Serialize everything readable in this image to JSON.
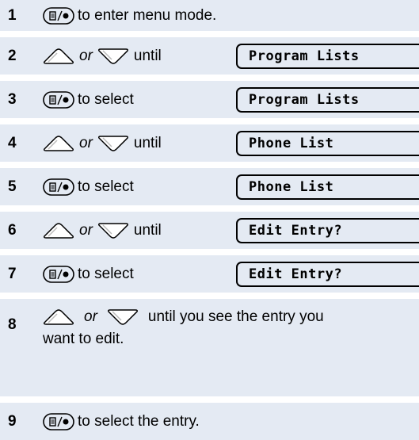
{
  "steps": [
    {
      "number": "1",
      "text": "to enter menu mode."
    },
    {
      "number": "2",
      "or_label": "or",
      "text": "until",
      "display": "Program Lists"
    },
    {
      "number": "3",
      "text": "to select",
      "display": "Program Lists"
    },
    {
      "number": "4",
      "or_label": "or",
      "text": "until",
      "display": "Phone List"
    },
    {
      "number": "5",
      "text": "to select",
      "display": "Phone List"
    },
    {
      "number": "6",
      "or_label": "or",
      "text": "until",
      "display": "Edit Entry?"
    },
    {
      "number": "7",
      "text": "to select",
      "display": "Edit Entry?"
    },
    {
      "number": "8",
      "or_label": "or",
      "text_line1": "until you see the entry you",
      "text_line2": "want to edit."
    },
    {
      "number": "9",
      "text": "to select the entry."
    }
  ],
  "icons": {
    "menu_select": "menu-select-button-icon",
    "up": "up-arrow-key-icon",
    "down": "down-arrow-key-icon"
  },
  "colors": {
    "row_background": "#e4eaf3",
    "border": "#000000"
  }
}
